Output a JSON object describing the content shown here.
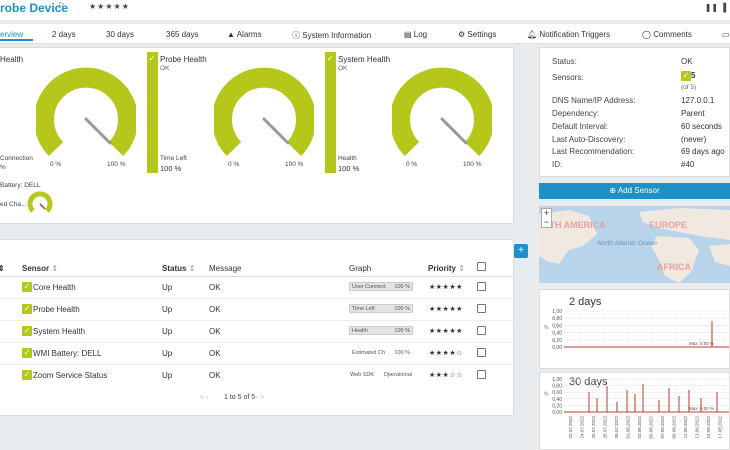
{
  "header": {
    "title": "robe Device",
    "stars": "★★★★★",
    "flag": "⚐",
    "controls": "❚❚ ▐"
  },
  "tabs": [
    {
      "label": "erview"
    },
    {
      "label": "2  days"
    },
    {
      "label": "30  days"
    },
    {
      "label": "365  days"
    },
    {
      "label": "Alarms"
    },
    {
      "label": "System Information"
    },
    {
      "label": "Log"
    },
    {
      "label": "Settings"
    },
    {
      "label": "Notification Triggers"
    },
    {
      "label": "Comments"
    }
  ],
  "gauges": [
    {
      "title": "Health",
      "sub": "",
      "min": "0 %",
      "max": "100 %",
      "foot": "Connection",
      "foot2": "%",
      "value": ""
    },
    {
      "title": "Probe Health",
      "sub": "OK",
      "min": "0 %",
      "max": "100 %",
      "foot": "Time Left",
      "foot2": "",
      "value": "100 %"
    },
    {
      "title": "System Health",
      "sub": "OK",
      "min": "0 %",
      "max": "100 %",
      "foot": "Health",
      "foot2": "",
      "value": "100 %"
    }
  ],
  "mini_gauge": {
    "title": "Battery: DELL",
    "foot": "ed Cha..."
  },
  "table": {
    "headers": {
      "sensor": "Sensor",
      "status": "Status",
      "message": "Message",
      "graph": "Graph",
      "priority": "Priority"
    },
    "rows": [
      {
        "sensor": "Core Health",
        "status": "Up",
        "message": "OK",
        "graph_label": "User Connect",
        "graph_value": "100 %",
        "priority": "★★★★★"
      },
      {
        "sensor": "Probe Health",
        "status": "Up",
        "message": "OK",
        "graph_label": "Time Left",
        "graph_value": "100 %",
        "priority": "★★★★★"
      },
      {
        "sensor": "System Health",
        "status": "Up",
        "message": "OK",
        "graph_label": "Health",
        "graph_value": "100 %",
        "priority": "★★★★★"
      },
      {
        "sensor": "WMI Battery: DELL",
        "status": "Up",
        "message": "OK",
        "graph_label": "Estimated Ch",
        "graph_value": "100 %",
        "priority": "★★★★☆"
      },
      {
        "sensor": "Zoom Service Status",
        "status": "Up",
        "message": "OK",
        "graph_label": "Web SDK",
        "graph_value": "Operational",
        "priority": "★★★☆☆"
      }
    ],
    "pagination": "1 to 5 of 5"
  },
  "info": [
    {
      "label": "Status:",
      "value": "OK"
    },
    {
      "label": "Sensors:",
      "value": "5"
    },
    {
      "label": "",
      "value": "(of 5)"
    },
    {
      "label": "DNS Name/IP Address:",
      "value": "127.0.0.1"
    },
    {
      "label": "Dependency:",
      "value": "Parent"
    },
    {
      "label": "Default Interval:",
      "value": "60 seconds"
    },
    {
      "label": "Last Auto-Discovery:",
      "value": "(never)"
    },
    {
      "label": "Last Recommendation:",
      "value": "69 days ago"
    },
    {
      "label": "ID:",
      "value": "#40"
    }
  ],
  "add_sensor": "Add Sensor",
  "map_labels": [
    "RTH AMERICA",
    "EUROPE",
    "AFRICA",
    "North Atlantic Ocean"
  ],
  "charts": [
    {
      "title": "2 days",
      "y_ticks": [
        "1,00",
        "0,80",
        "0,60",
        "0,40",
        "0,20",
        "0,00"
      ],
      "note": "Max: 0,00 %"
    },
    {
      "title": "30 days",
      "y_ticks": [
        "1,00",
        "0,80",
        "0,60",
        "0,40",
        "0,20",
        "0,00"
      ],
      "note": "Max: 0,00 %",
      "x_ticks": [
        "22.07.2022",
        "24.07.2022",
        "26.07.2022",
        "28.07.2022",
        "30.07.2022",
        "01.08.2022",
        "03.08.2022",
        "05.08.2022",
        "07.08.2022",
        "09.08.2022",
        "11.08.2022",
        "13.08.2022",
        "15.08.2022",
        "17.08.2022"
      ]
    }
  ],
  "colors": {
    "accent": "#1e90c8",
    "ok_green": "#b5c71a",
    "needle": "#888888",
    "chart_red": "#c0392b"
  }
}
